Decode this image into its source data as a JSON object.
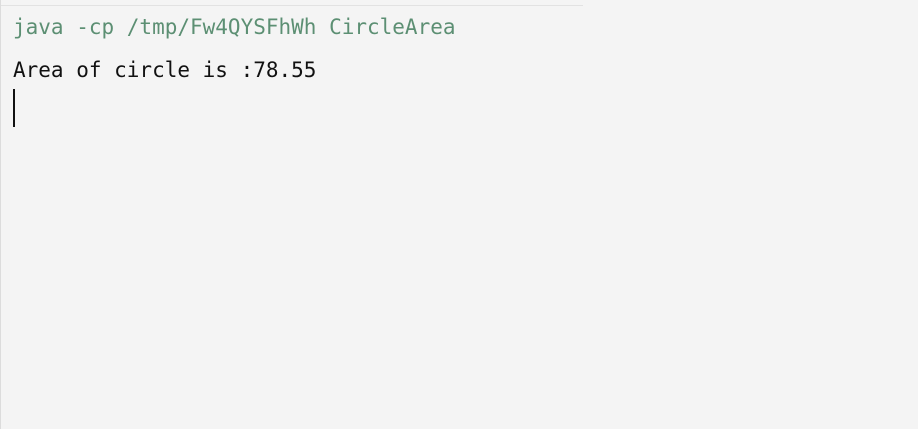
{
  "console": {
    "command": "java -cp /tmp/Fw4QYSFhWh CircleArea",
    "output": "Area of circle is :78.55"
  },
  "colors": {
    "background": "#f4f4f4",
    "command_text": "#5c8f73",
    "output_text": "#111111",
    "cursor": "#111111"
  }
}
